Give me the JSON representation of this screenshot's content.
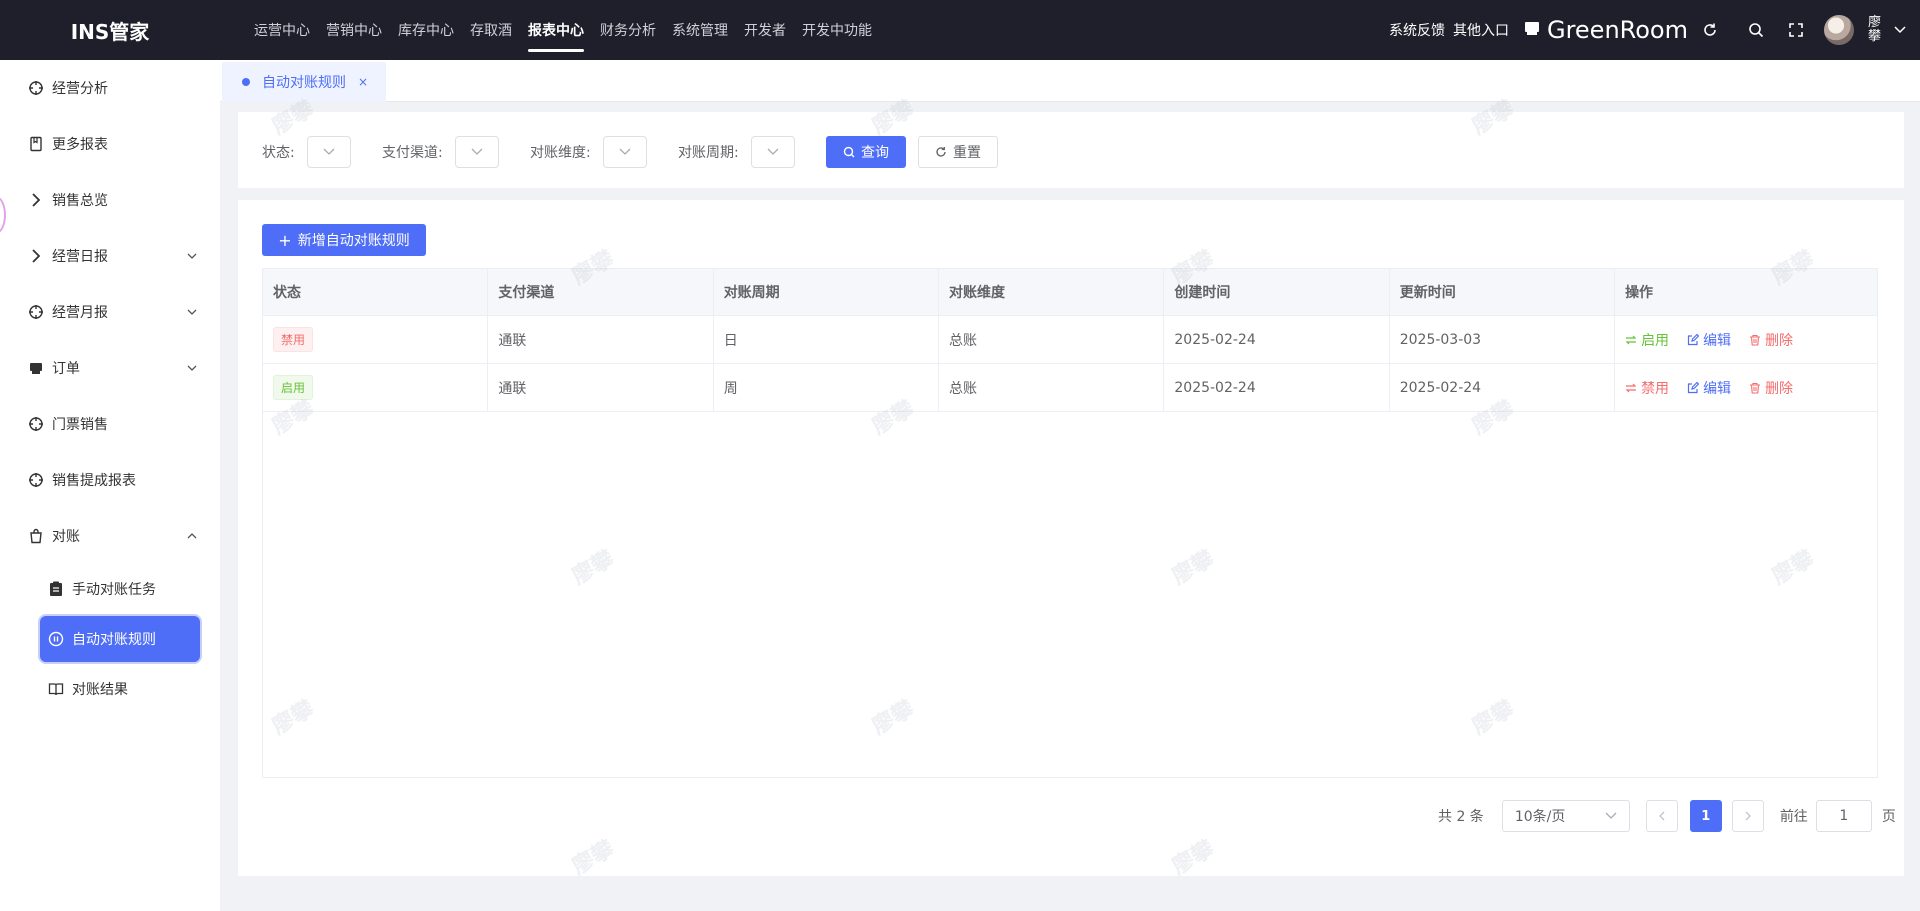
{
  "app": {
    "brand": "INS管家"
  },
  "topnav": [
    {
      "label": "运营中心",
      "active": false
    },
    {
      "label": "营销中心",
      "active": false
    },
    {
      "label": "库存中心",
      "active": false
    },
    {
      "label": "存取酒",
      "active": false
    },
    {
      "label": "报表中心",
      "active": true
    },
    {
      "label": "财务分析",
      "active": false
    },
    {
      "label": "系统管理",
      "active": false
    },
    {
      "label": "开发者",
      "active": false
    },
    {
      "label": "开发中功能",
      "active": false
    }
  ],
  "header_right": {
    "feedback": "系统反馈",
    "other_entry": "其他入口",
    "store_name": "GreenRoom",
    "user_name": "廖攀"
  },
  "sidebar": {
    "items": [
      {
        "label": "经营分析",
        "icon": "crosshair-icon"
      },
      {
        "label": "更多报表",
        "icon": "book-icon"
      },
      {
        "label": "销售总览",
        "icon": "chevron-right-icon"
      },
      {
        "label": "经营日报",
        "icon": "chevron-right-icon"
      },
      {
        "label": "经营月报",
        "icon": "crosshair-icon"
      },
      {
        "label": "订单",
        "icon": "order-icon"
      },
      {
        "label": "门票销售",
        "icon": "crosshair-icon"
      },
      {
        "label": "销售提成报表",
        "icon": "crosshair-icon"
      },
      {
        "label": "对账",
        "icon": "bag-icon"
      }
    ],
    "sub_items": [
      {
        "label": "手动对账任务",
        "icon": "clipboard-icon"
      },
      {
        "label": "自动对账规则",
        "icon": "pause-circle-icon"
      },
      {
        "label": "对账结果",
        "icon": "open-book-icon"
      }
    ]
  },
  "tabs": [
    {
      "label": "自动对账规则",
      "close": "×"
    }
  ],
  "filters": {
    "status": "状态:",
    "channel": "支付渠道:",
    "dimension": "对账维度:",
    "period": "对账周期:",
    "query": "查询",
    "reset": "重置"
  },
  "table": {
    "add_label": "新增自动对账规则",
    "columns": [
      "状态",
      "支付渠道",
      "对账周期",
      "对账维度",
      "创建时间",
      "更新时间",
      "操作"
    ],
    "rows": [
      {
        "status": "禁用",
        "status_type": "danger",
        "channel": "通联",
        "period": "日",
        "dimension": "总账",
        "created": "2025-02-24",
        "updated": "2025-03-03",
        "toggle": "启用",
        "edit": "编辑",
        "delete": "删除"
      },
      {
        "status": "启用",
        "status_type": "success",
        "channel": "通联",
        "period": "周",
        "dimension": "总账",
        "created": "2025-02-24",
        "updated": "2025-02-24",
        "toggle": "禁用",
        "edit": "编辑",
        "delete": "删除"
      }
    ]
  },
  "pagination": {
    "total": "共 2 条",
    "page_size": "10条/页",
    "current": "1",
    "goto_label": "前往",
    "goto_value": "1",
    "page_unit": "页"
  },
  "watermark": "廖攀",
  "colors": {
    "primary": "#4f6ef7",
    "topbar": "#1f1f2b",
    "success": "#67c23a",
    "danger": "#f56c6c"
  }
}
